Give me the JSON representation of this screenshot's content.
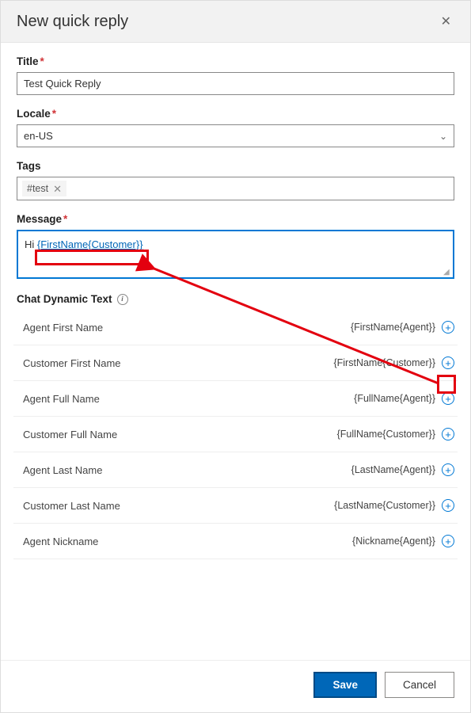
{
  "header": {
    "title": "New quick reply",
    "close": "✕"
  },
  "fields": {
    "title_label": "Title",
    "title_value": "Test Quick Reply",
    "locale_label": "Locale",
    "locale_value": "en-US",
    "tags_label": "Tags",
    "tag_value": "#test",
    "message_label": "Message",
    "message_prefix": "Hi ",
    "message_token": "{FirstName{Customer}}"
  },
  "dynamic": {
    "section_title": "Chat Dynamic Text",
    "items": [
      {
        "label": "Agent First Name",
        "token": "{FirstName{Agent}}"
      },
      {
        "label": "Customer First Name",
        "token": "{FirstName{Customer}}"
      },
      {
        "label": "Agent Full Name",
        "token": "{FullName{Agent}}"
      },
      {
        "label": "Customer Full Name",
        "token": "{FullName{Customer}}"
      },
      {
        "label": "Agent Last Name",
        "token": "{LastName{Agent}}"
      },
      {
        "label": "Customer Last Name",
        "token": "{LastName{Customer}}"
      },
      {
        "label": "Agent Nickname",
        "token": "{Nickname{Agent}}"
      }
    ]
  },
  "footer": {
    "save": "Save",
    "cancel": "Cancel"
  }
}
